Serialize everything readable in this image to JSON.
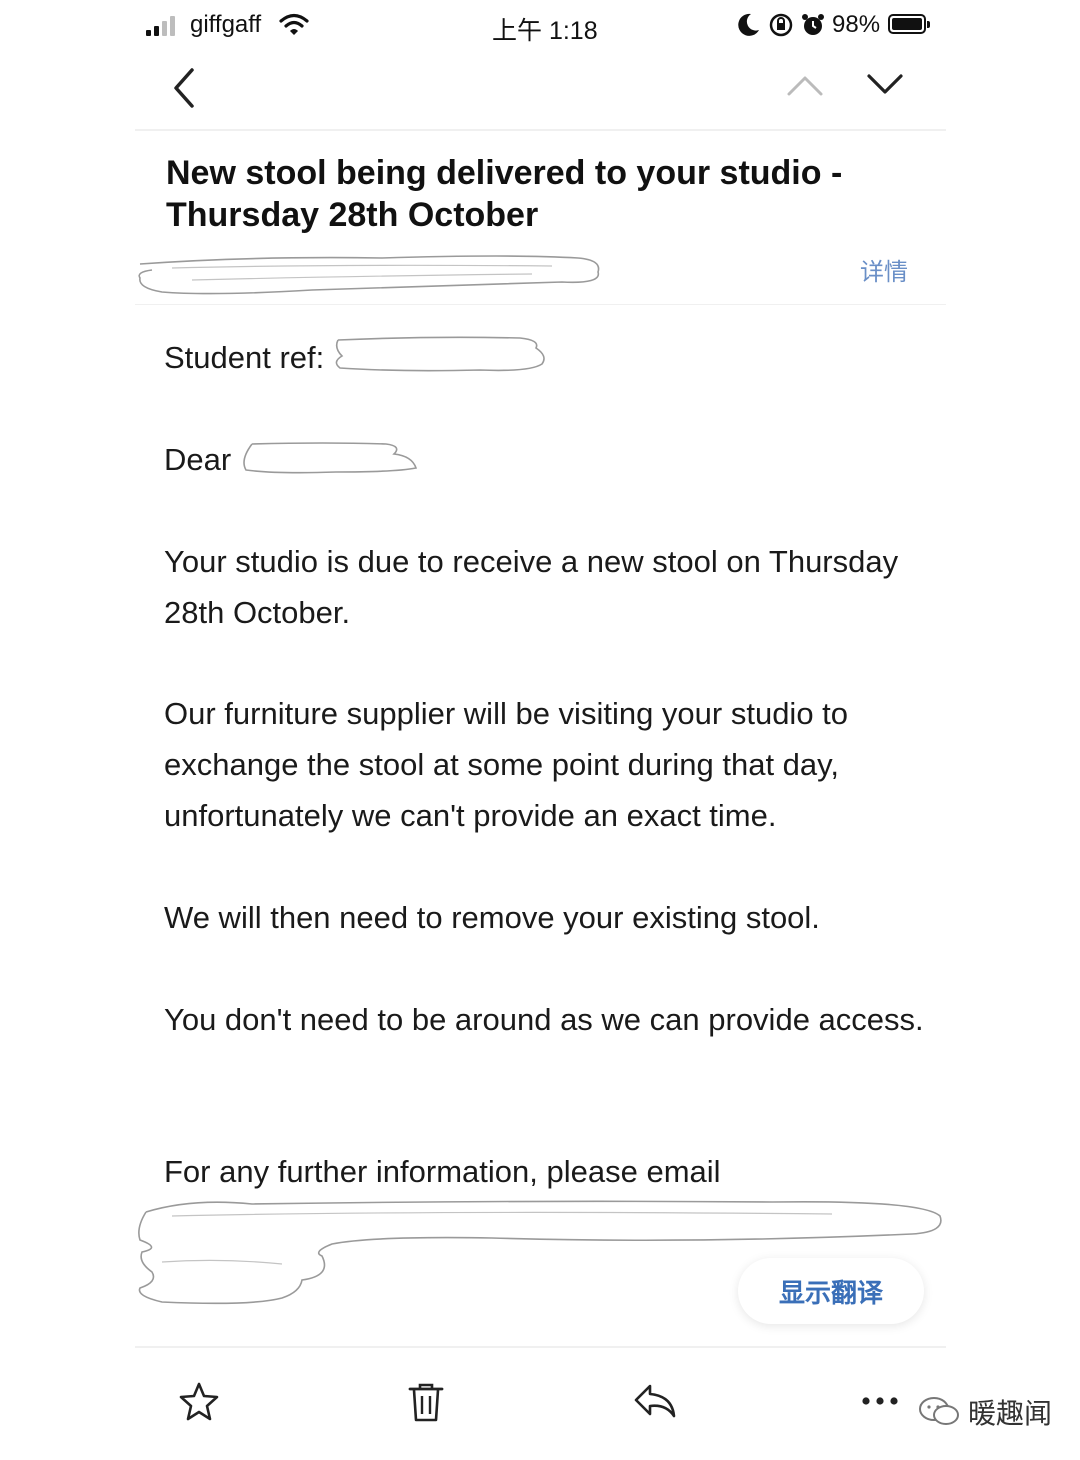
{
  "status_bar": {
    "carrier": "giffgaff",
    "time": "上午 1:18",
    "battery_percent": "98%",
    "icons": [
      "signal-icon",
      "wifi-icon",
      "moon-icon",
      "rotation-lock-icon",
      "alarm-icon",
      "battery-icon"
    ]
  },
  "nav": {
    "back_icon": "chevron-left-icon",
    "prev_icon": "chevron-up-icon",
    "next_icon": "chevron-down-icon"
  },
  "email": {
    "subject": "New stool being delivered to your studio - Thursday 28th October",
    "details_link": "详情",
    "student_ref_label": "Student ref:",
    "greeting": "Dear",
    "paragraphs": [
      "Your studio is due to receive a new stool on Thursday 28th October.",
      "Our furniture supplier will be visiting your studio to exchange the stool at some point during that day, unfortunately we can't provide an exact time.",
      "We will then need to remove your existing stool.",
      "You don't need to be around as we can provide access.",
      "For any further information, please email"
    ]
  },
  "translate_button": "显示翻译",
  "toolbar": {
    "icons": [
      "star-icon",
      "trash-icon",
      "reply-icon",
      "more-icon"
    ]
  },
  "watermark": "暖趣闻",
  "colors": {
    "link": "#6a8fc7",
    "translate": "#3a6fb8"
  }
}
